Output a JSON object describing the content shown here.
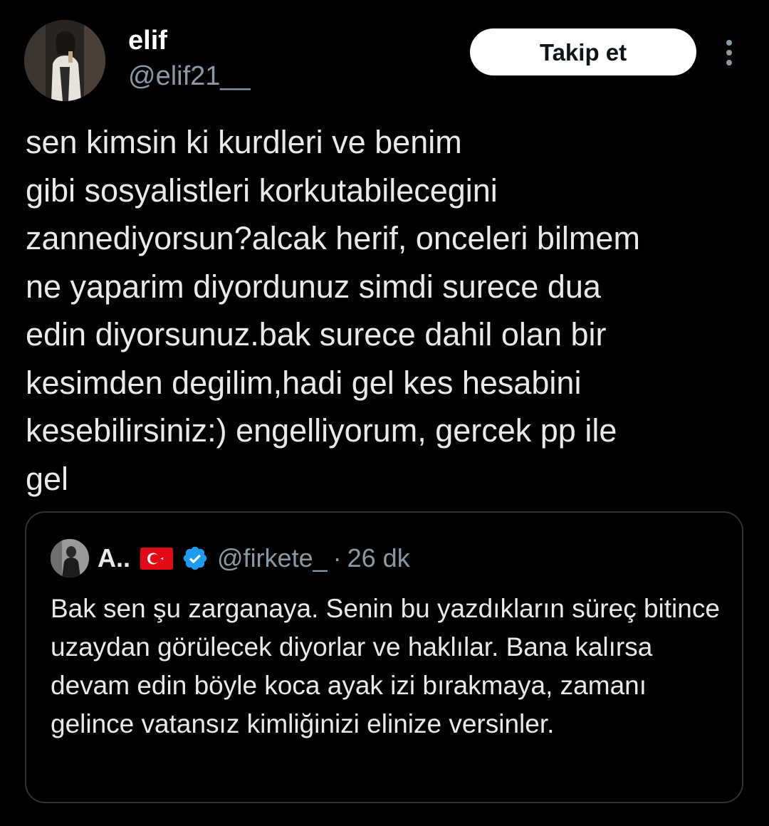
{
  "author": {
    "display_name": "elif",
    "handle": "@elif21__",
    "follow_label": "Takip et"
  },
  "tweet": {
    "text_lines": [
      "sen kimsin ki kurdleri ve benim",
      "gibi sosyalistleri korkutabilecegini",
      "zannediyorsun?alcak herif, onceleri bilmem",
      "ne yaparim diyordunuz simdi surece dua",
      "edin diyorsunuz.bak surece dahil olan bir",
      "kesimden degilim,hadi gel kes hesabini",
      "kesebilirsiniz:) engelliyorum, gercek pp ile",
      "gel"
    ]
  },
  "quoted_tweet": {
    "display_name": "A..",
    "handle": "@firkete_",
    "separator": "·",
    "time": "26 dk",
    "text": "Bak sen şu zarganaya. Senin bu yazdıkların süreç bitince uzaydan görülecek diyorlar ve haklılar. Bana kalırsa devam edin böyle koca ayak izi bırakmaya, zamanı gelince vatansız kimliğinizi elinize versinler."
  },
  "icons": {
    "more": "more-vertical-icon",
    "verified": "verified-badge-icon",
    "flag": "turkey-flag-icon"
  },
  "colors": {
    "background": "#000000",
    "text_primary": "#e7e9ea",
    "text_secondary": "#8b98a5",
    "border": "#2f3336",
    "verified_blue": "#1d9bf0",
    "flag_red": "#e30a17",
    "button_bg": "#ffffff"
  }
}
